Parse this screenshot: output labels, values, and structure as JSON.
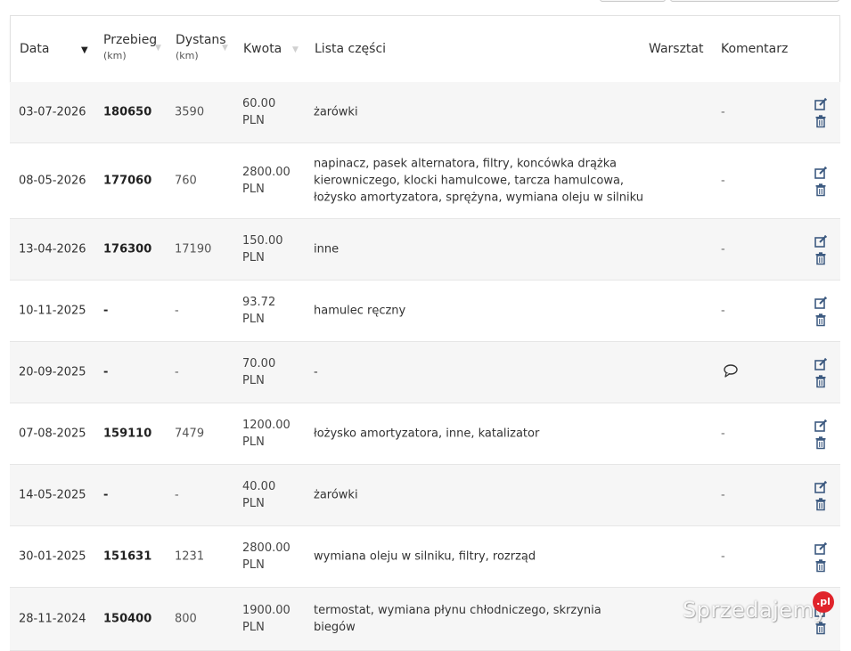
{
  "header": {
    "date": "Data",
    "mileage": "Przebieg",
    "mileage_unit": "(km)",
    "distance": "Dystans",
    "distance_unit": "(km)",
    "amount": "Kwota",
    "parts": "Lista części",
    "workshop": "Warsztat",
    "comment": "Komentarz"
  },
  "rows": [
    {
      "date": "03-07-2026",
      "mileage": "180650",
      "distance": "3590",
      "amount": "60.00\nPLN",
      "parts": "żarówki",
      "comment": "-"
    },
    {
      "date": "08-05-2026",
      "mileage": "177060",
      "distance": "760",
      "amount": "2800.00\nPLN",
      "parts": "napinacz, pasek alternatora, filtry, koncówka drążka kierowniczego, klocki hamulcowe, tarcza hamulcowa, łożysko amortyzatora, sprężyna, wymiana oleju w silniku",
      "comment": "-"
    },
    {
      "date": "13-04-2026",
      "mileage": "176300",
      "distance": "17190",
      "amount": "150.00\nPLN",
      "parts": "inne",
      "comment": "-"
    },
    {
      "date": "10-11-2025",
      "mileage": "-",
      "distance": "-",
      "amount": "93.72\nPLN",
      "parts": "hamulec ręczny",
      "comment": "-"
    },
    {
      "date": "20-09-2025",
      "mileage": "-",
      "distance": "-",
      "amount": "70.00\nPLN",
      "parts": "-",
      "comment": ""
    },
    {
      "date": "07-08-2025",
      "mileage": "159110",
      "distance": "7479",
      "amount": "1200.00\nPLN",
      "parts": "łożysko amortyzatora, inne, katalizator",
      "comment": "-"
    },
    {
      "date": "14-05-2025",
      "mileage": "-",
      "distance": "-",
      "amount": "40.00\nPLN",
      "parts": "żarówki",
      "comment": "-"
    },
    {
      "date": "30-01-2025",
      "mileage": "151631",
      "distance": "1231",
      "amount": "2800.00\nPLN",
      "parts": "wymiana oleju w silniku, filtry, rozrząd",
      "comment": "-"
    },
    {
      "date": "28-11-2024",
      "mileage": "150400",
      "distance": "800",
      "amount": "1900.00\nPLN",
      "parts": "termostat, wymiana płynu chłodniczego, skrzynia biegów",
      "comment": ""
    }
  ],
  "watermark": {
    "text": "Sprzedajemy",
    "badge": ".pl"
  },
  "colors": {
    "row_alt": "#f6f6f6",
    "border": "#e6e6e6",
    "icon": "#3d5a80",
    "badge": "#e0242b"
  }
}
